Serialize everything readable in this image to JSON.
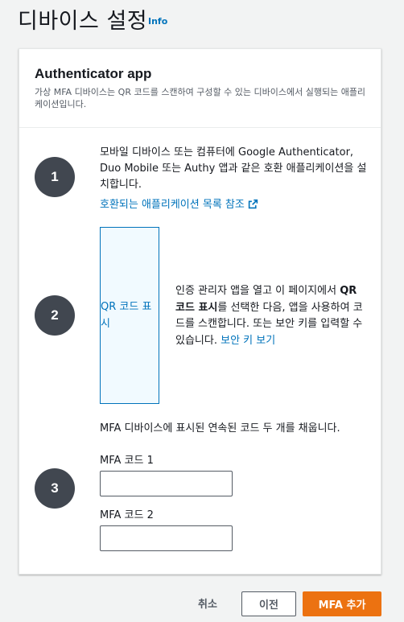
{
  "page": {
    "title": "디바이스 설정",
    "info_link": "Info"
  },
  "card": {
    "title": "Authenticator app",
    "description": "가상 MFA 디바이스는 QR 코드를 스캔하여 구성할 수 있는 디바이스에서 실행되는 애플리케이션입니다."
  },
  "steps": [
    {
      "number": "1",
      "text_line1": "모바일 디바이스 또는 컴퓨터에 Google Authenticator,",
      "text_line2": "Duo Mobile 또는 Authy 앱과 같은 호환 애플리케이션을 설",
      "text_line3": "치합니다.",
      "link": "호환되는 애플리케이션 목록 참조"
    },
    {
      "number": "2",
      "qr_button": "QR 코드 표시",
      "text_part1": "인증 관리자 앱을 열고 이 페이지에서 ",
      "text_bold": "QR 코드 표시",
      "text_part2": "를 선택한 다음, 앱을 사용하여 코드를 스캔합니다. 또는 보안 키를 입력할 수 있습니다. ",
      "link": "보안 키 보기"
    },
    {
      "number": "3",
      "instruction": "MFA 디바이스에 표시된 연속된 코드 두 개를 채웁니다.",
      "field1_label": "MFA 코드 1",
      "field1_value": "",
      "field2_label": "MFA 코드 2",
      "field2_value": ""
    }
  ],
  "footer": {
    "cancel": "취소",
    "previous": "이전",
    "add_mfa": "MFA 추가"
  },
  "colors": {
    "link": "#0073bb",
    "primary_button": "#ec7211",
    "step_circle": "#414750"
  },
  "icons": {
    "external_link": "external-link-icon"
  }
}
